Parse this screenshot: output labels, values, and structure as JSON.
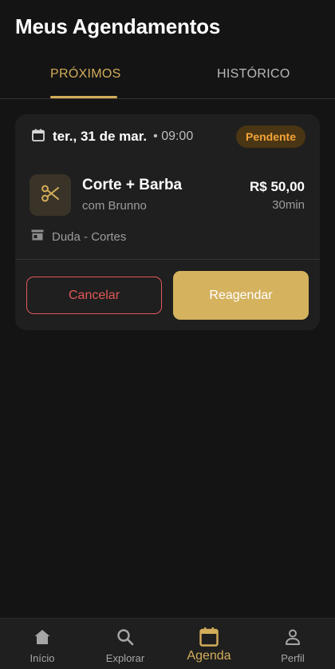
{
  "header": {
    "title": "Meus Agendamentos"
  },
  "tabs": [
    {
      "label": "PRÓXIMOS",
      "active": true
    },
    {
      "label": "HISTÓRICO",
      "active": false
    }
  ],
  "appointment": {
    "date": "ter., 31 de mar.",
    "time": "• 09:00",
    "status": "Pendente",
    "service": "Corte + Barba",
    "professional": "com Brunno",
    "price": "R$ 50,00",
    "duration": "30min",
    "shop": "Duda - Cortes",
    "cancel_label": "Cancelar",
    "reschedule_label": "Reagendar",
    "icons": {
      "date": "calendar-icon",
      "service": "scissors-icon",
      "shop": "store-icon"
    }
  },
  "nav": [
    {
      "label": "Início",
      "icon": "home-icon",
      "active": false
    },
    {
      "label": "Explorar",
      "icon": "search-icon",
      "active": false
    },
    {
      "label": "Agenda",
      "icon": "calendar-icon",
      "active": true
    },
    {
      "label": "Perfil",
      "icon": "person-icon",
      "active": false
    }
  ],
  "colors": {
    "background": "#141414",
    "card": "#1f1f1f",
    "accent": "#d3ad5a",
    "danger": "#e05858",
    "pending": "#f3a437"
  }
}
